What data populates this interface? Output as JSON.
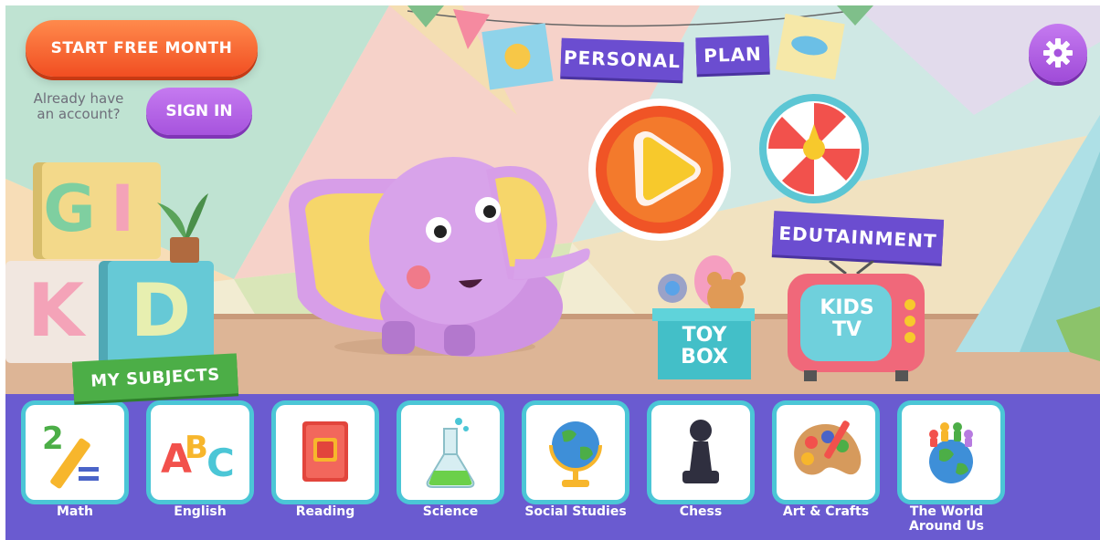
{
  "header": {
    "start_label": "START FREE MONTH",
    "account_note": "Already have an account?",
    "signin_label": "SIGN IN"
  },
  "icons": {
    "settings": "gear-icon",
    "play": "play-icon",
    "spinner": "prize-wheel-icon"
  },
  "banner": {
    "word1": "PERSONAL",
    "word2": "PLAN"
  },
  "blocks": [
    "G",
    "I",
    "K",
    "D"
  ],
  "edutainment_label": "EDUTAINMENT",
  "toybox_label": "TOY BOX",
  "kidstv_label": "KIDS TV",
  "subjects": {
    "title": "MY SUBJECTS",
    "items": [
      {
        "label": "Math",
        "icon": "math-icon"
      },
      {
        "label": "English",
        "icon": "abc-icon"
      },
      {
        "label": "Reading",
        "icon": "book-icon"
      },
      {
        "label": "Science",
        "icon": "flask-icon"
      },
      {
        "label": "Social Studies",
        "icon": "globe-icon"
      },
      {
        "label": "Chess",
        "icon": "chess-pawn-icon"
      },
      {
        "label": "Art & Crafts",
        "icon": "palette-icon"
      },
      {
        "label": "The World Around Us",
        "icon": "world-icon"
      }
    ]
  },
  "colors": {
    "accent_orange": "#f14e22",
    "accent_purple": "#a653dd",
    "dock": "#6a5bd0",
    "tile_border": "#4bc6d6",
    "subjects_green": "#4cae47"
  }
}
